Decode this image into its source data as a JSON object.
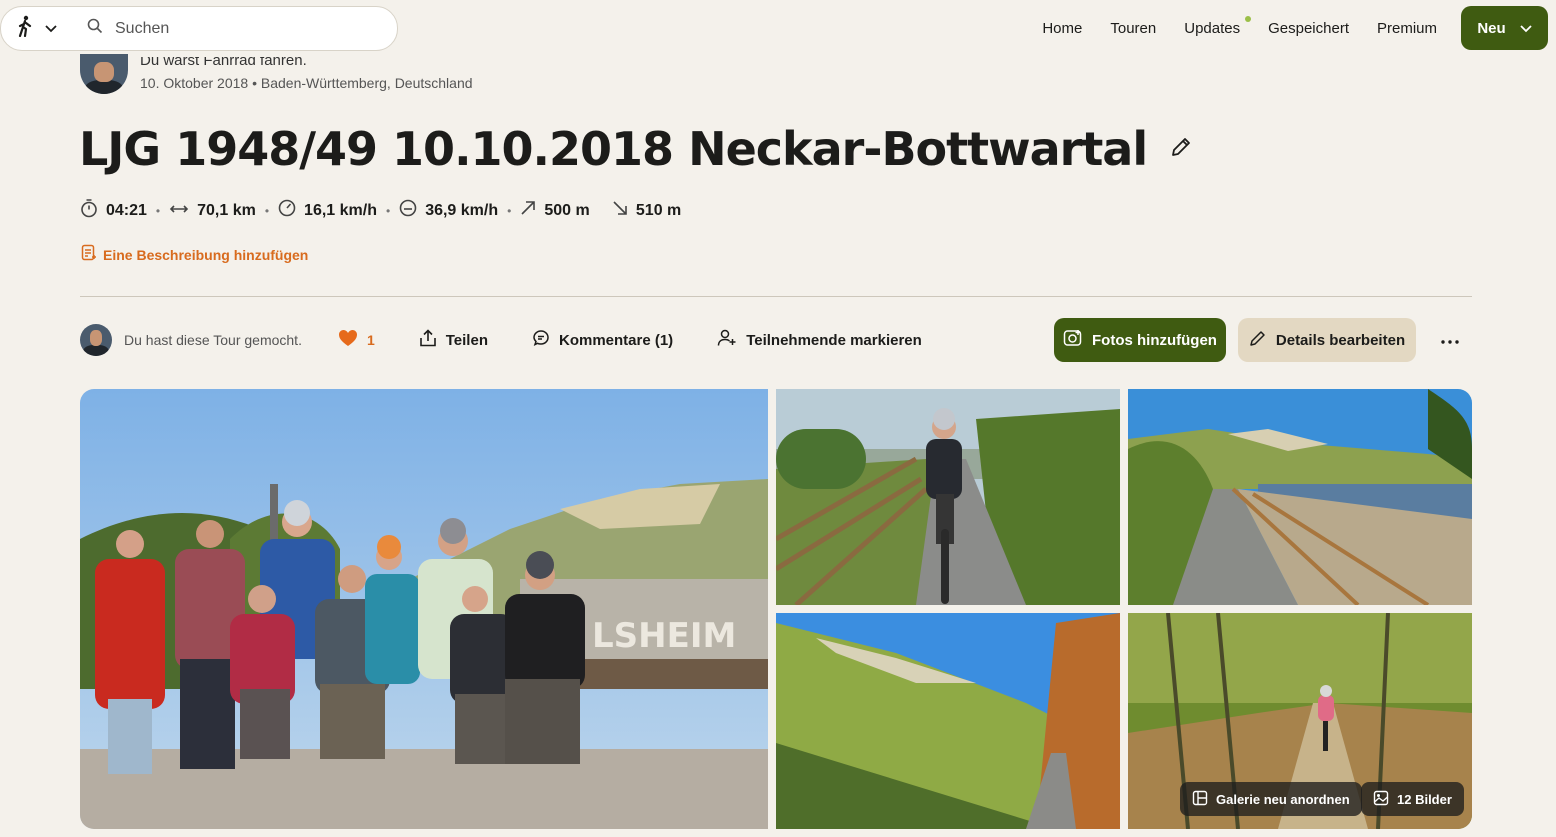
{
  "search": {
    "placeholder": "Suchen"
  },
  "nav": {
    "home": "Home",
    "tours": "Touren",
    "updates": "Updates",
    "saved": "Gespeichert",
    "premium": "Premium",
    "new_label": "Neu"
  },
  "tour": {
    "author_line": "Du warst Fahrrad fahren.",
    "date_location": "10. Oktober 2018 • Baden-Württemberg, Deutschland",
    "title": "LJG 1948/49 10.10.2018 Neckar-Bottwartal",
    "stats": {
      "duration": "04:21",
      "distance": "70,1 km",
      "avg_speed": "16,1 km/h",
      "max_speed": "36,9 km/h",
      "uphill": "500 m",
      "downhill": "510 m"
    },
    "add_description": "Eine Beschreibung hinzufügen"
  },
  "actions": {
    "liked_text": "Du hast diese Tour gemocht.",
    "like_count": "1",
    "share": "Teilen",
    "comments": "Kommentare (1)",
    "tag_participants": "Teilnehmende markieren",
    "add_photos": "Fotos hinzufügen",
    "edit_details": "Details bearbeiten"
  },
  "gallery": {
    "main_sign_text": "LSHEIM",
    "rearrange": "Galerie neu anordnen",
    "image_count": "12 Bilder"
  },
  "colors": {
    "background": "#f4f1eb",
    "primary_green": "#3f5b11",
    "accent_orange": "#d86b1e",
    "secondary_button": "#e3d8c2",
    "updates_dot": "#9bbf48"
  },
  "icons": [
    "hiking-icon",
    "chevron-down-icon",
    "search-icon",
    "stopwatch-icon",
    "distance-icon",
    "speedometer-icon",
    "max-speed-icon",
    "uphill-icon",
    "downhill-icon",
    "description-icon",
    "pencil-icon",
    "heart-icon",
    "share-icon",
    "comment-icon",
    "user-plus-icon",
    "camera-plus-icon",
    "more-icon",
    "gallery-layout-icon",
    "image-icon"
  ]
}
